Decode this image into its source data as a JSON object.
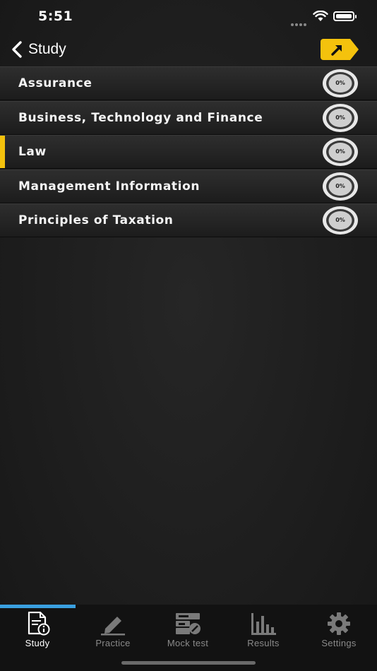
{
  "status_bar": {
    "time": "5:51"
  },
  "nav": {
    "back_label": "Study",
    "share_icon": "share-arrow-icon",
    "accent_color": "#f4c20d"
  },
  "subjects": [
    {
      "label": "Assurance",
      "progress": "0%",
      "selected": false
    },
    {
      "label": "Business, Technology and Finance",
      "progress": "0%",
      "selected": false
    },
    {
      "label": "Law",
      "progress": "0%",
      "selected": true
    },
    {
      "label": "Management Information",
      "progress": "0%",
      "selected": false
    },
    {
      "label": "Principles of Taxation",
      "progress": "0%",
      "selected": false
    }
  ],
  "tabs": [
    {
      "label": "Study",
      "icon": "study-document-icon",
      "active": true
    },
    {
      "label": "Practice",
      "icon": "pencil-icon",
      "active": false
    },
    {
      "label": "Mock test",
      "icon": "mock-test-icon",
      "active": false
    },
    {
      "label": "Results",
      "icon": "bar-chart-icon",
      "active": false
    },
    {
      "label": "Settings",
      "icon": "gear-icon",
      "active": false
    }
  ],
  "colors": {
    "tab_active_indicator": "#3aa0e0",
    "selected_row_accent": "#f4c20d"
  }
}
